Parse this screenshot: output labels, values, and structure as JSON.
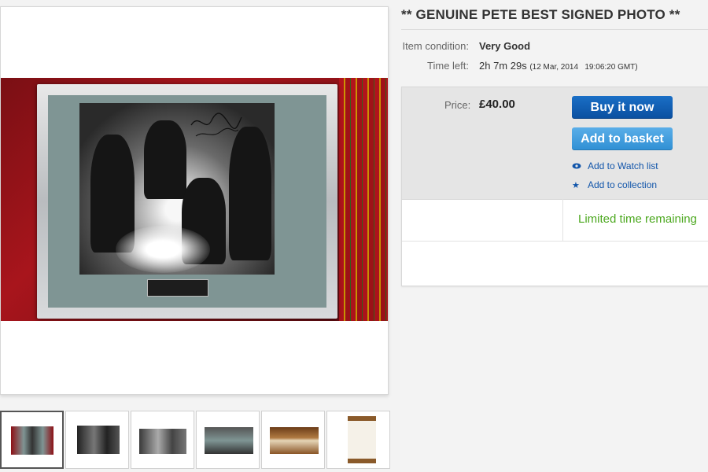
{
  "listing": {
    "title": "** GENUINE PETE BEST SIGNED PHOTO **",
    "condition_label": "Item condition:",
    "condition_value": "Very Good",
    "time_left_label": "Time left:",
    "time_left_value": "2h 7m 29s",
    "end_time": "(12 Mar, 2014   19:06:20 GMT)"
  },
  "buybox": {
    "price_label": "Price:",
    "price_value": "£40.00",
    "buy_now_label": "Buy it now",
    "add_basket_label": "Add to basket",
    "watch_label": "Add to Watch list",
    "collection_label": "Add to collection",
    "limited_label": "Limited time remaining"
  },
  "icons": {
    "watch": "eye-icon",
    "collection": "star-icon"
  },
  "colors": {
    "buy_now": "#0a4fa0",
    "add_basket": "#2f8fd4",
    "link": "#1155aa",
    "limited": "#4ca81f"
  },
  "thumbnails": [
    "thumb-1",
    "thumb-2",
    "thumb-3",
    "thumb-4",
    "thumb-5",
    "thumb-6"
  ],
  "selected_thumbnail": 1
}
